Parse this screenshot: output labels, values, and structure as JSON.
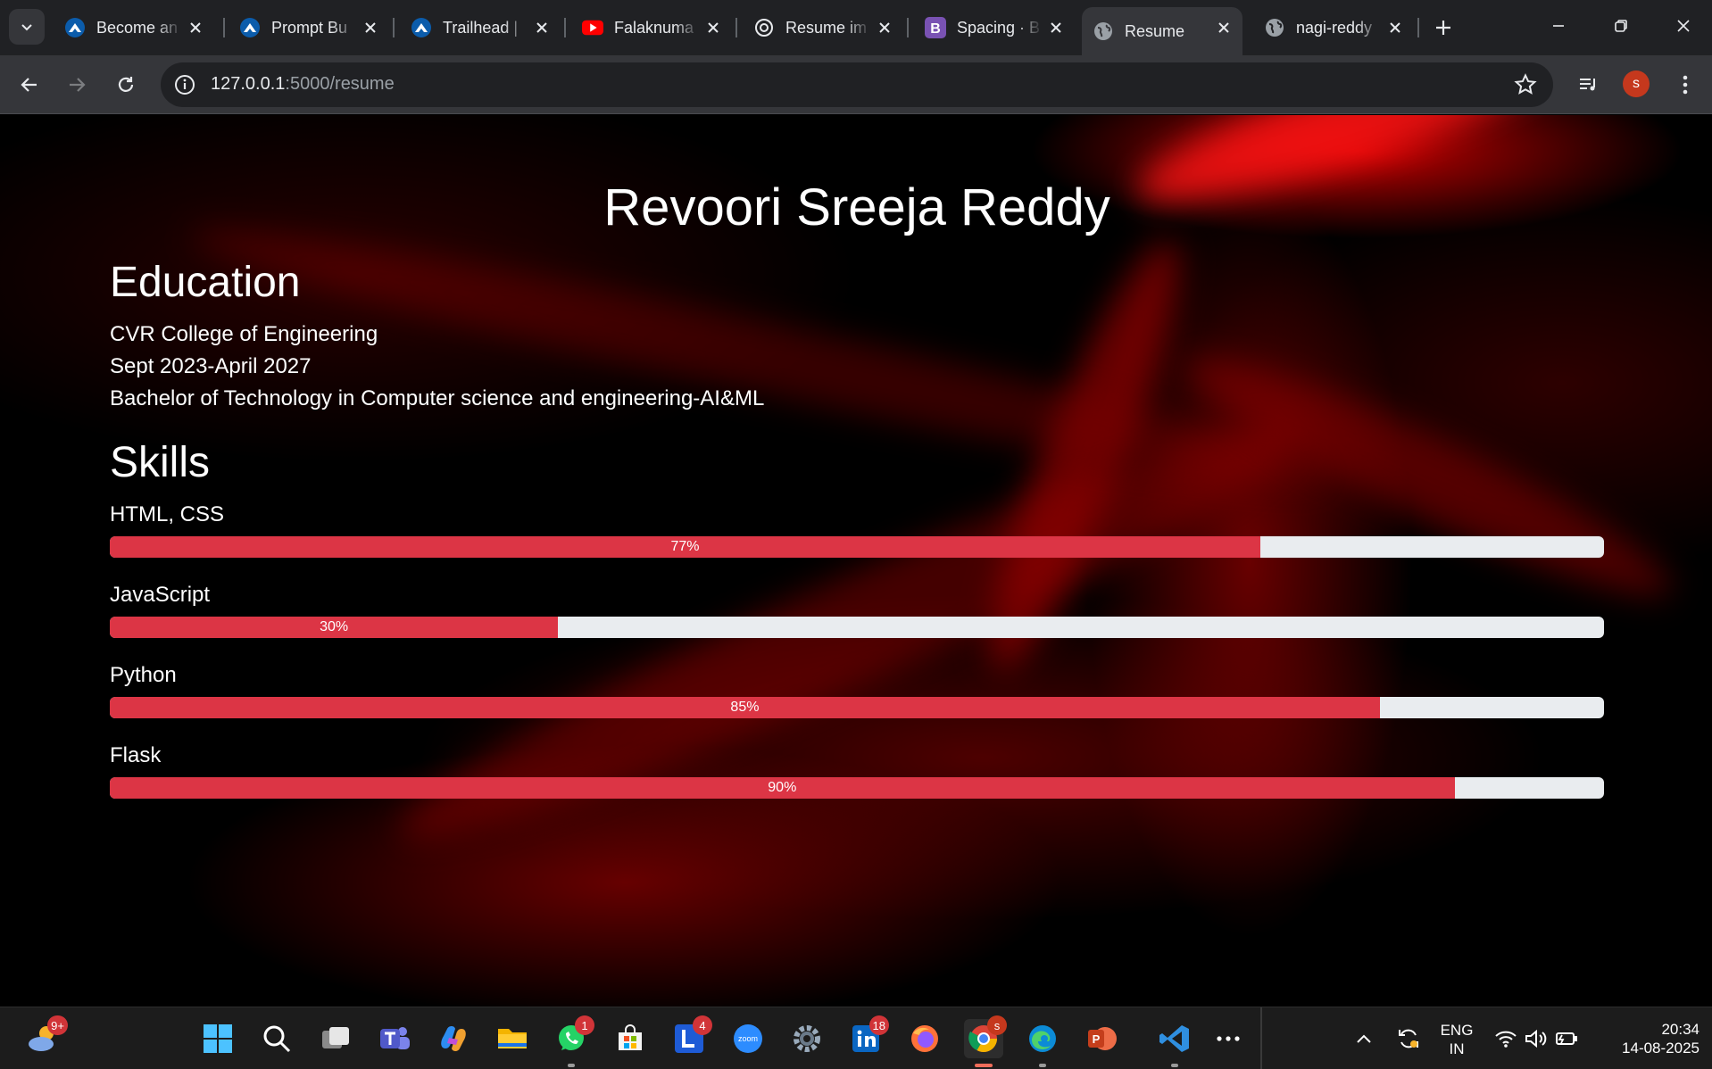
{
  "browser": {
    "tabs": [
      {
        "title": "Become an",
        "icon": "trailhead-icon"
      },
      {
        "title": "Prompt Bu",
        "icon": "trailhead-icon"
      },
      {
        "title": "Trailhead |",
        "icon": "trailhead-icon"
      },
      {
        "title": "Falaknuma",
        "icon": "youtube-icon"
      },
      {
        "title": "Resume im",
        "icon": "chatgpt-icon"
      },
      {
        "title": "Spacing · B",
        "icon": "bootstrap-icon"
      },
      {
        "title": "Resume",
        "icon": "globe-icon",
        "active": true
      },
      {
        "title": "nagi-reddy",
        "icon": "globe-icon"
      }
    ],
    "url_host": "127.0.0.1",
    "url_path": ":5000/resume",
    "profile_initial": "s"
  },
  "resume": {
    "name": "Revoori Sreeja Reddy",
    "education_heading": "Education",
    "education": {
      "college": "CVR College of Engineering",
      "dates": "Sept 2023-April 2027",
      "degree": "Bachelor of Technology in Computer science and engineering-AI&ML"
    },
    "skills_heading": "Skills",
    "skills": [
      {
        "name": "HTML, CSS",
        "percent": 77,
        "label": "77%"
      },
      {
        "name": "JavaScript",
        "percent": 30,
        "label": "30%"
      },
      {
        "name": "Python",
        "percent": 85,
        "label": "85%"
      },
      {
        "name": "Flask",
        "percent": 90,
        "label": "90%"
      }
    ],
    "colors": {
      "bar_fill": "#dc3545",
      "bar_track": "#e9ecef"
    }
  },
  "taskbar": {
    "weather_badge": "9+",
    "whatsapp_badge": "1",
    "l_app_badge": "4",
    "linkedin_badge": "18",
    "chrome_badge": "s",
    "language_top": "ENG",
    "language_bottom": "IN",
    "time": "20:34",
    "date": "14-08-2025"
  }
}
